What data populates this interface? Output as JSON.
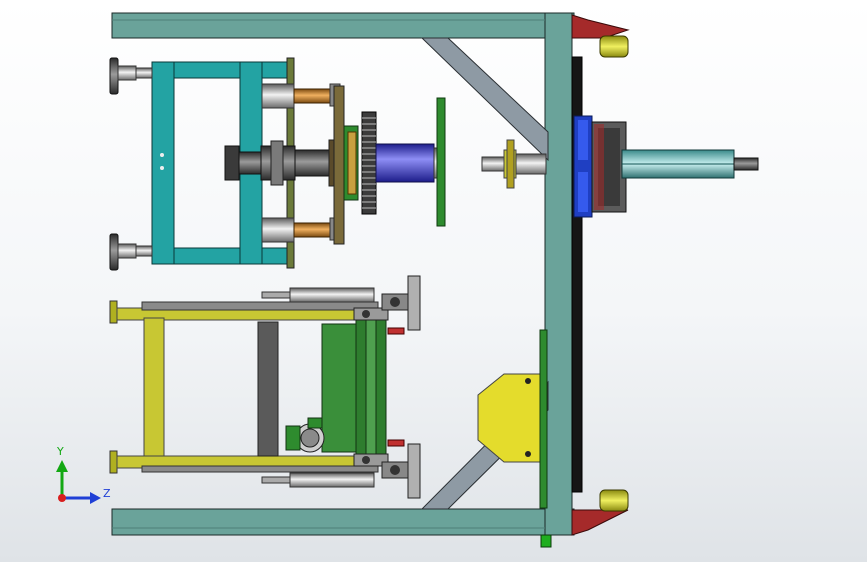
{
  "view": {
    "background_top": "#ffffff",
    "background_bottom": "#dfe3e7"
  },
  "triad": {
    "y_label": "Y",
    "z_label": "Z",
    "y_color": "#13a813",
    "z_color": "#1f3fd6",
    "x_color": "#d81e1e"
  },
  "colors": {
    "frame": "#6aa39a",
    "teal_frame": "#23a3a3",
    "yellow_frame": "#c8c733",
    "brace": "#8e9aa4",
    "gear": "#3b3b3b",
    "roller": "#4747d8",
    "green_plate": "#2e8b2e",
    "motor_blue": "#1f3fc2",
    "red_bracket": "#a52a2a",
    "yellow_block": "#e4dc2c",
    "black_rail": "#151515"
  }
}
